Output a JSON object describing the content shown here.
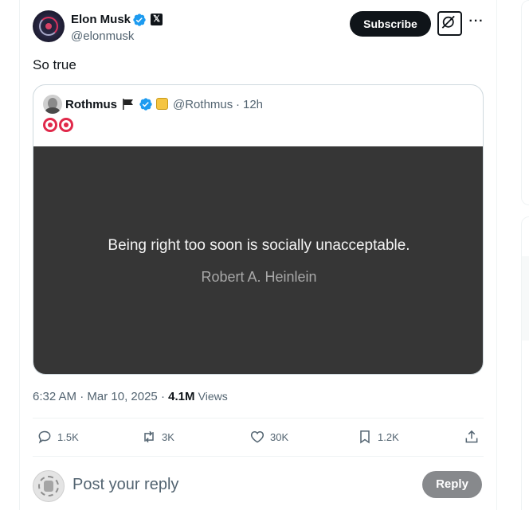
{
  "author": {
    "name": "Elon Musk",
    "handle": "@elonmusk",
    "x_badge": "𝕏",
    "avatar_icon": "blackhole-avatar"
  },
  "header": {
    "subscribe_label": "Subscribe",
    "grok_icon": "grok-icon",
    "more_label": "···"
  },
  "tweet": {
    "text": "So true"
  },
  "quote": {
    "name": "Rothmus",
    "handle": "@Rothmus",
    "separator": "·",
    "time": "12h",
    "emojis": [
      "🎯",
      "🎯"
    ],
    "image_quote": "Being right too soon is socially unacceptable.",
    "image_author": "Robert A. Heinlein"
  },
  "meta": {
    "time": "6:32 AM",
    "sep1": "·",
    "date": "Mar 10, 2025",
    "sep2": "·",
    "views_count": "4.1M",
    "views_label": "Views"
  },
  "actions": {
    "replies": "1.5K",
    "reposts": "3K",
    "likes": "30K",
    "bookmarks": "1.2K"
  },
  "reply": {
    "placeholder": "Post your reply",
    "button": "Reply"
  },
  "colors": {
    "accent": "#1d9bf0",
    "text": "#0f1419",
    "muted": "#536471",
    "image_bg": "#363636",
    "reply_button_disabled": "#87898c"
  }
}
